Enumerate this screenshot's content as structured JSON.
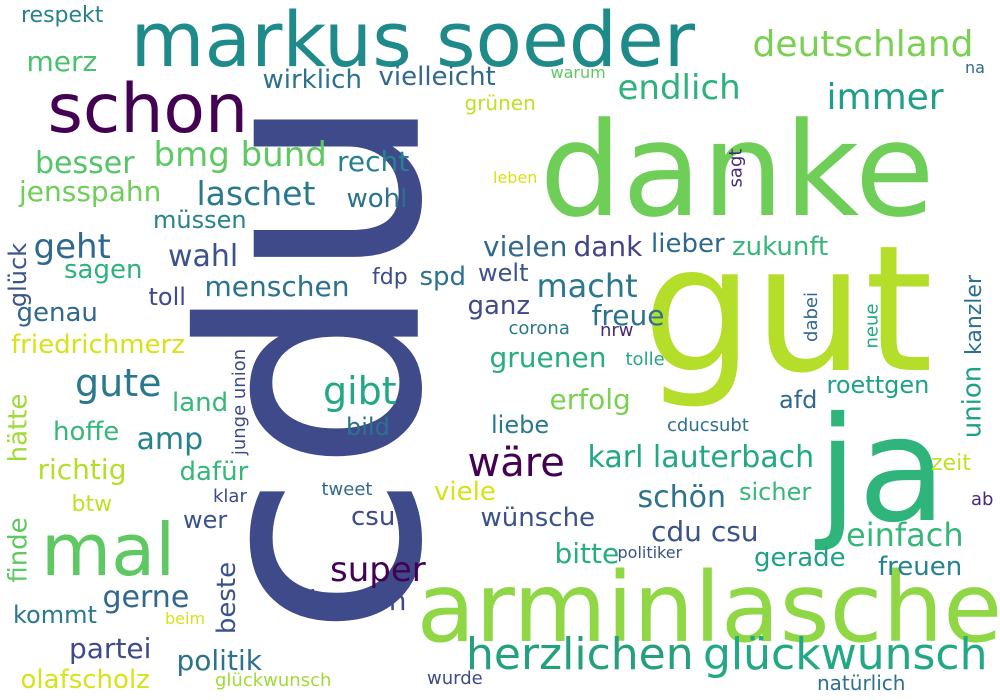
{
  "palette": {
    "dark_purple": "#440154",
    "indigo": "#3e4a89",
    "blue": "#31688e",
    "teal": "#26828e",
    "sea_green": "#1f9e89",
    "green": "#35b779",
    "light_green": "#6ece58",
    "lime": "#b5de2b",
    "yellow": "#e5e419"
  },
  "words": [
    {
      "text": "cdu",
      "color": "#3e4a89"
    },
    {
      "text": "danke",
      "color": "#6ece58"
    },
    {
      "text": "gut",
      "color": "#b5de2b"
    },
    {
      "text": "markus soeder",
      "color": "#1f8a8a"
    },
    {
      "text": "ja",
      "color": "#2fb47c"
    },
    {
      "text": "arminlaschet",
      "color": "#8fd744"
    },
    {
      "text": "schon",
      "color": "#440154"
    },
    {
      "text": "mal",
      "color": "#5ec962"
    },
    {
      "text": "herzlichen",
      "color": "#25a07f"
    },
    {
      "text": "glückwunsch",
      "color": "#22a884"
    },
    {
      "text": "deutschland",
      "color": "#7ad151"
    },
    {
      "text": "immer",
      "color": "#1f9e89"
    },
    {
      "text": "endlich",
      "color": "#2db27d"
    },
    {
      "text": "bmg bund",
      "color": "#5ec962"
    },
    {
      "text": "laschet",
      "color": "#2a788e"
    },
    {
      "text": "recht",
      "color": "#26828e"
    },
    {
      "text": "wirklich",
      "color": "#2c728e"
    },
    {
      "text": "vielleicht",
      "color": "#31688e"
    },
    {
      "text": "respekt",
      "color": "#26828e"
    },
    {
      "text": "merz",
      "color": "#4ac16d"
    },
    {
      "text": "besser",
      "color": "#52c569"
    },
    {
      "text": "jensspahn",
      "color": "#6ece58"
    },
    {
      "text": "wohl",
      "color": "#2c728e"
    },
    {
      "text": "müssen",
      "color": "#26828e"
    },
    {
      "text": "geht",
      "color": "#31688e"
    },
    {
      "text": "sagen",
      "color": "#2db27d"
    },
    {
      "text": "wahl",
      "color": "#3b528b"
    },
    {
      "text": "vielen",
      "color": "#31688e"
    },
    {
      "text": "dank",
      "color": "#414487"
    },
    {
      "text": "lieber",
      "color": "#31688e"
    },
    {
      "text": "zukunft",
      "color": "#35b779"
    },
    {
      "text": "grünen",
      "color": "#c2df23"
    },
    {
      "text": "warum",
      "color": "#5ec962"
    },
    {
      "text": "na",
      "color": "#31688e"
    },
    {
      "text": "leben",
      "color": "#d8e219"
    },
    {
      "text": "sagt",
      "color": "#482878"
    },
    {
      "text": "glück",
      "color": "#3b528b"
    },
    {
      "text": "genau",
      "color": "#31688e"
    },
    {
      "text": "friedrichmerz",
      "color": "#d8e219"
    },
    {
      "text": "toll",
      "color": "#3e4a89"
    },
    {
      "text": "menschen",
      "color": "#2c728e"
    },
    {
      "text": "fdp",
      "color": "#3e4a89"
    },
    {
      "text": "spd",
      "color": "#2c728e"
    },
    {
      "text": "welt",
      "color": "#3b528b"
    },
    {
      "text": "macht",
      "color": "#2a788e"
    },
    {
      "text": "ganz",
      "color": "#3e4a89"
    },
    {
      "text": "freue",
      "color": "#2c728e"
    },
    {
      "text": "corona",
      "color": "#2a788e"
    },
    {
      "text": "nrw",
      "color": "#482878"
    },
    {
      "text": "gruenen",
      "color": "#26ad81"
    },
    {
      "text": "tolle",
      "color": "#22a884"
    },
    {
      "text": "kanzler",
      "color": "#2c728e"
    },
    {
      "text": "dabei",
      "color": "#31688e"
    },
    {
      "text": "neue",
      "color": "#22a884"
    },
    {
      "text": "gute",
      "color": "#2a788e"
    },
    {
      "text": "gibt",
      "color": "#22a884"
    },
    {
      "text": "land",
      "color": "#35b779"
    },
    {
      "text": "roettgen",
      "color": "#1fa188"
    },
    {
      "text": "afd",
      "color": "#31688e"
    },
    {
      "text": "union",
      "color": "#1fa188"
    },
    {
      "text": "finde",
      "color": "#5ec962"
    },
    {
      "text": "hätte",
      "color": "#a0da39"
    },
    {
      "text": "hoffe",
      "color": "#35b779"
    },
    {
      "text": "amp",
      "color": "#26828e"
    },
    {
      "text": "junge union",
      "color": "#3e4a89"
    },
    {
      "text": "bild",
      "color": "#2c728e"
    },
    {
      "text": "erfolg",
      "color": "#7ad151"
    },
    {
      "text": "liebe",
      "color": "#2a788e"
    },
    {
      "text": "cducsubt",
      "color": "#2c728e"
    },
    {
      "text": "wäre",
      "color": "#440154"
    },
    {
      "text": "karl lauterbach",
      "color": "#22a884"
    },
    {
      "text": "zeit",
      "color": "#c2df23"
    },
    {
      "text": "richtig",
      "color": "#b5de2b"
    },
    {
      "text": "dafür",
      "color": "#35b779"
    },
    {
      "text": "btw",
      "color": "#c2df23"
    },
    {
      "text": "klar",
      "color": "#3e4a89"
    },
    {
      "text": "wer",
      "color": "#3b528b"
    },
    {
      "text": "tweet",
      "color": "#31688e"
    },
    {
      "text": "viele",
      "color": "#d8e219"
    },
    {
      "text": "schön",
      "color": "#2c728e"
    },
    {
      "text": "sicher",
      "color": "#35b779"
    },
    {
      "text": "ab",
      "color": "#482878"
    },
    {
      "text": "wünsche",
      "color": "#3b528b"
    },
    {
      "text": "csu",
      "color": "#3e4a89"
    },
    {
      "text": "cdu csu",
      "color": "#3b528b"
    },
    {
      "text": "einfach",
      "color": "#35b779"
    },
    {
      "text": "bitte",
      "color": "#26ad81"
    },
    {
      "text": "gerade",
      "color": "#1fa188"
    },
    {
      "text": "politiker",
      "color": "#3b528b"
    },
    {
      "text": "freuen",
      "color": "#26828e"
    },
    {
      "text": "super",
      "color": "#440154"
    },
    {
      "text": "gerne",
      "color": "#31688e"
    },
    {
      "text": "beste",
      "color": "#3b528b"
    },
    {
      "text": "bayern",
      "color": "#3e4a89"
    },
    {
      "text": "kommt",
      "color": "#2a788e"
    },
    {
      "text": "partei",
      "color": "#3e4a89"
    },
    {
      "text": "beim",
      "color": "#d8e219"
    },
    {
      "text": "politik",
      "color": "#2c728e"
    },
    {
      "text": "olafscholz",
      "color": "#d8e219"
    },
    {
      "text": "glückwunsch",
      "color": "#a0da39"
    },
    {
      "text": "wurde",
      "color": "#3e4a89"
    },
    {
      "text": "natürlich",
      "color": "#2c728e"
    }
  ]
}
